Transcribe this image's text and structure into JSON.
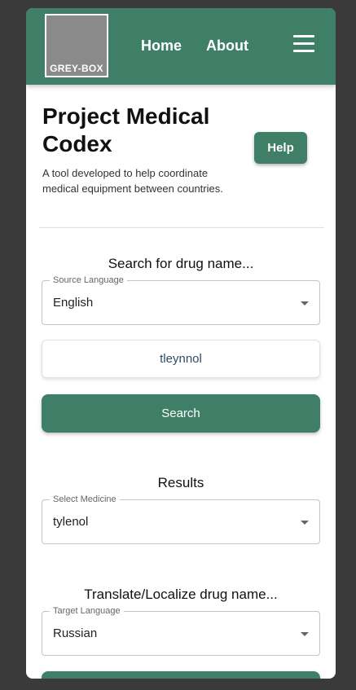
{
  "navbar": {
    "logo_text": "GREY-BOX",
    "home_label": "Home",
    "about_label": "About",
    "menu_icon": "hamburger-icon",
    "color": "#3f7f67"
  },
  "header": {
    "title": "Project Medical Codex",
    "subtitle": "A tool developed to help coordinate medical equipment between countries.",
    "help_label": "Help"
  },
  "search": {
    "heading": "Search for drug name...",
    "source_language_label": "Source Language",
    "source_language_value": "English",
    "query_value": "tleynnol",
    "search_label": "Search"
  },
  "results": {
    "heading": "Results",
    "select_label": "Select Medicine",
    "select_value": "tylenol"
  },
  "translate": {
    "heading": "Translate/Localize drug name...",
    "target_language_label": "Target Language",
    "target_language_value": "Russian"
  },
  "colors": {
    "accent": "#3f7f67",
    "background": "#3a3a3a"
  }
}
